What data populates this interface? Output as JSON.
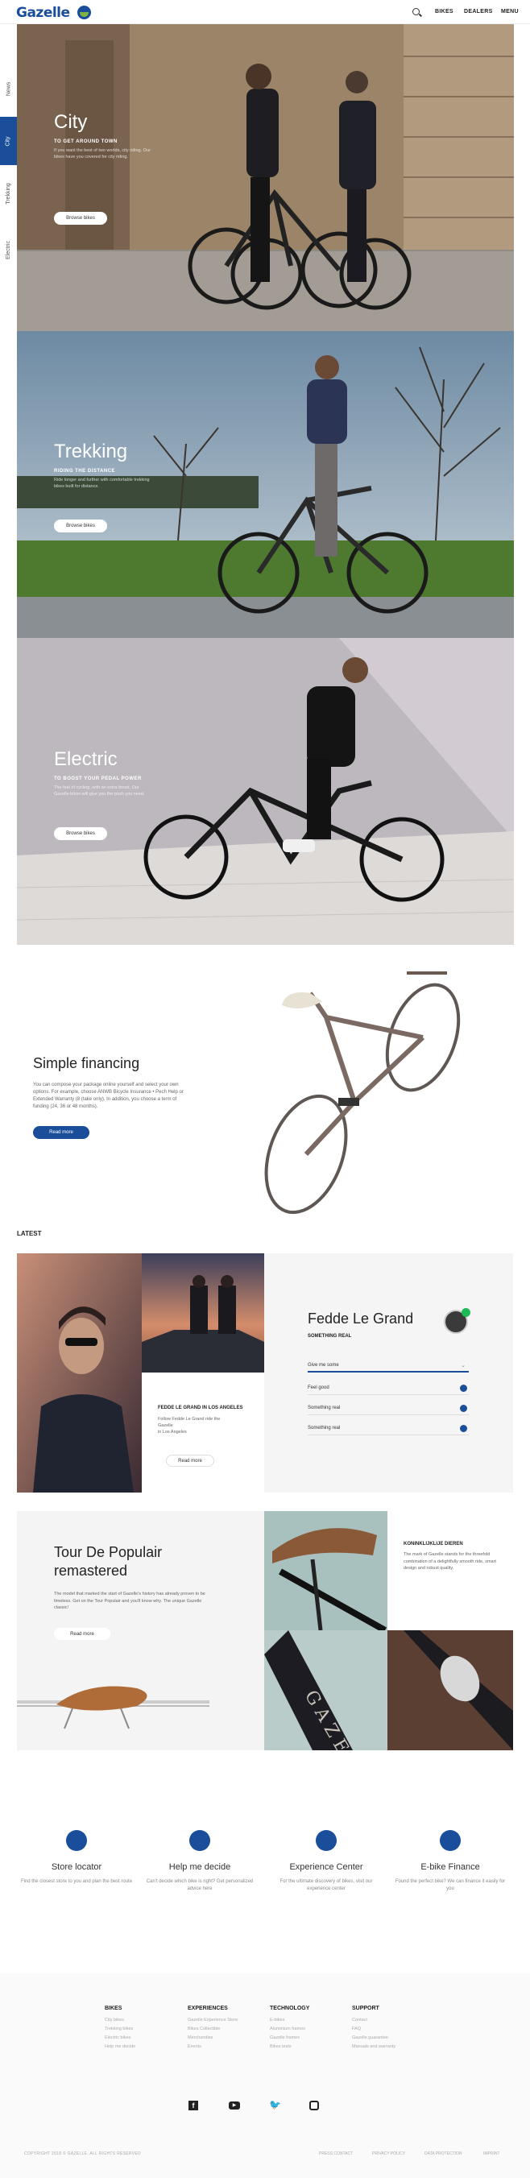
{
  "header": {
    "logo": "Gazelle",
    "nav": [
      "BIKES",
      "DEALERS",
      "MENU"
    ]
  },
  "sidenav": [
    {
      "label": "News"
    },
    {
      "label": "City",
      "active": true
    },
    {
      "label": "Trekking"
    },
    {
      "label": "Electric"
    }
  ],
  "heroes": [
    {
      "title": "City",
      "subtitle": "TO GET AROUND TOWN",
      "desc": "If you want the best of two worlds, city riding. Our bikes have you covered for city riding.",
      "button": "Browse bikes"
    },
    {
      "title": "Trekking",
      "subtitle": "RIDING THE DISTANCE",
      "desc": "Ride longer and further with comfortable trekking bikes built for distance.",
      "button": "Browse bikes"
    },
    {
      "title": "Electric",
      "subtitle": "TO BOOST YOUR PEDAL POWER",
      "desc": "The feel of cycling, with an extra boost. Our Gazelle bikes will give you the push you need.",
      "button": "Browse bikes"
    }
  ],
  "financing": {
    "title": "Simple financing",
    "desc": "You can compose your package online yourself and select your own options. For example, choose ANWB Bicycle Insurance • Pech Help or Extended Warranty (8 (take only). In addition, you choose a term of funding (24, 36 or 48 months).",
    "button": "Read more"
  },
  "latest": {
    "heading": "LATEST",
    "feature": {
      "title": "FEDDE LE GRAND IN LOS ANGELES",
      "lines": [
        "Follow Fedde Le Grand ride the",
        "Gazelle",
        "in Los Angeles"
      ],
      "button": "Read more"
    },
    "poll": {
      "name": "Fedde Le Grand",
      "track": "SOMETHING REAL",
      "rows": [
        "Give me some",
        "Feel good",
        "Something real",
        "Something real"
      ]
    }
  },
  "tour": {
    "title": "Tour De Populair remastered",
    "desc": "The model that marked the start of Gazelle's history has already proven to be timeless. Get on the Tour Populair and you'll know why. The unique Gazelle classic!",
    "button": "Read more",
    "royal_title": "KONINKLIJKLIJE DIEREN",
    "royal_desc": "The mark of Gazelle stands for the threefold combination of a delightfully smooth ride, smart design and robust quality."
  },
  "services": [
    {
      "icon": "location-icon",
      "title": "Store locator",
      "desc": "Find the closest store to you and plan the best route"
    },
    {
      "icon": "dots-icon",
      "title": "Help me decide",
      "desc": "Can't decide which bike is right? Get personalized advice here"
    },
    {
      "icon": "compass-icon",
      "title": "Experience Center",
      "desc": "For the ultimate discovery of bikes, visit our experience center"
    },
    {
      "icon": "chat-icon",
      "title": "E-bike Finance",
      "desc": "Found the perfect bike? We can finance it easily for you"
    }
  ],
  "footer": {
    "columns": [
      {
        "title": "BIKES",
        "items": [
          "City bikes",
          "Trekking bikes",
          "Electric bikes",
          "Help me decide"
        ]
      },
      {
        "title": "EXPERIENCES",
        "items": [
          "Gazelle Experience Store",
          "Bikes Collectible",
          "Merchandise",
          "Events"
        ]
      },
      {
        "title": "TECHNOLOGY",
        "items": [
          "E-bikes",
          "Aluminium frames",
          "Gazelle frames",
          "Bikes tests"
        ]
      },
      {
        "title": "SUPPORT",
        "items": [
          "Contact",
          "FAQ",
          "Gazelle guarantee",
          "Manuals and warranty"
        ]
      }
    ],
    "social": [
      "facebook-icon",
      "youtube-icon",
      "twitter-icon",
      "instagram-icon"
    ],
    "copyright": "COPYRIGHT 2018 © GAZELLE. ALL RIGHTS RESERVED",
    "links": [
      "PRESS CONTACT",
      "PRIVACY POLICY",
      "DATA PROTECTION",
      "IMPRINT"
    ]
  },
  "colors": {
    "brand": "#1a4e9b",
    "accent": "#7fb241"
  }
}
